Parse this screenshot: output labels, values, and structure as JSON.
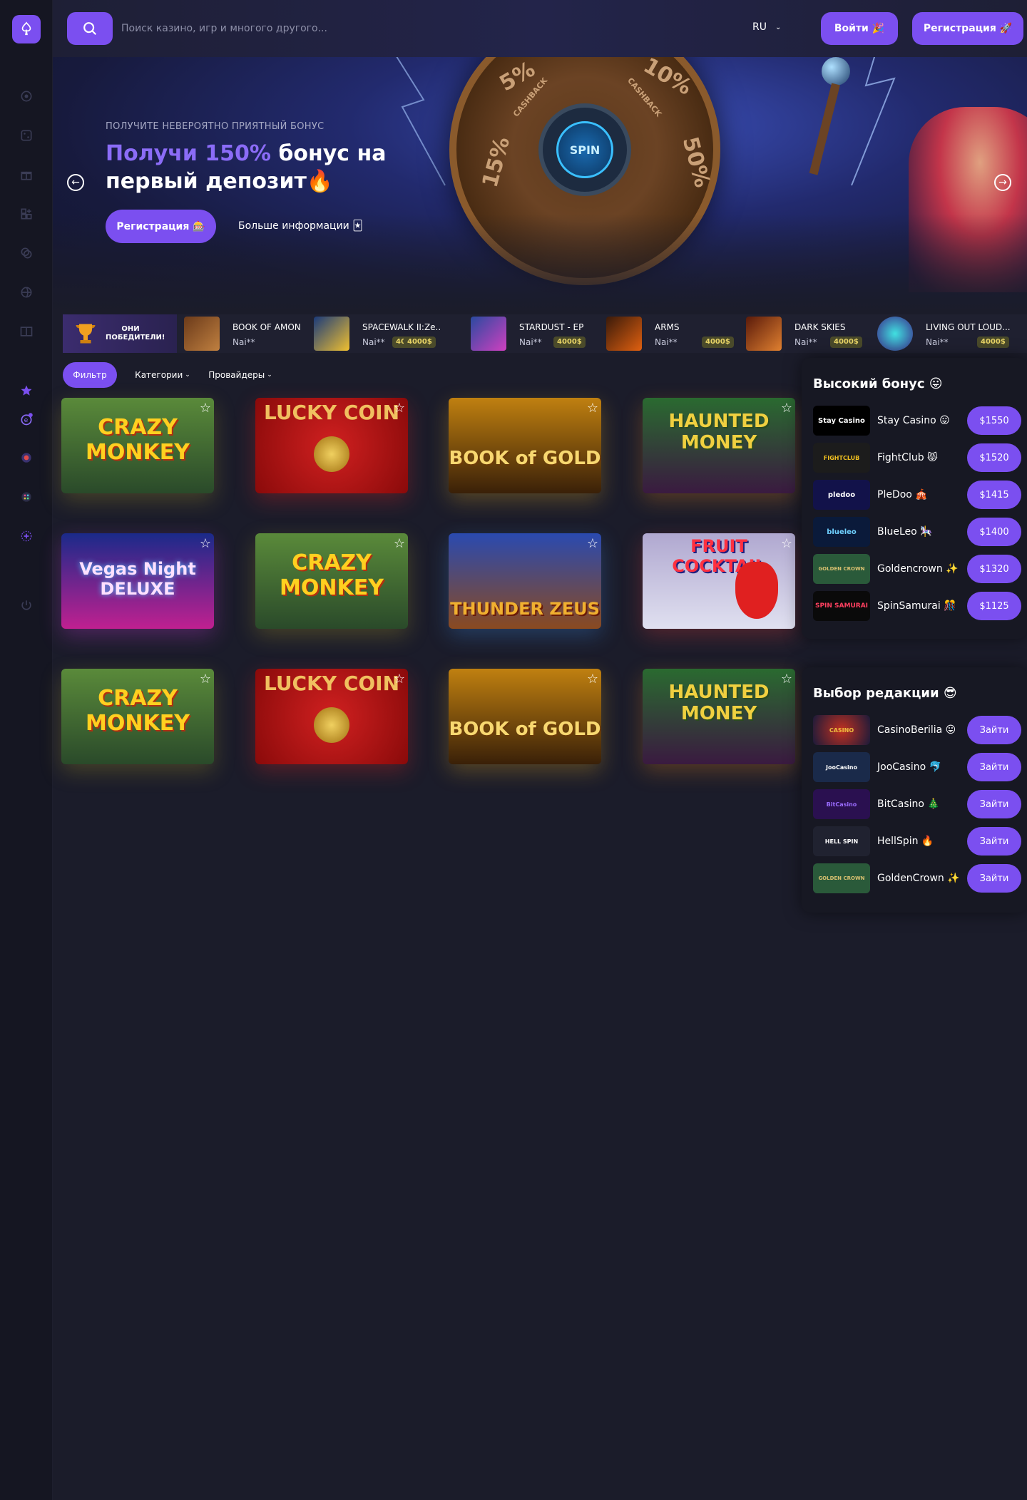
{
  "header": {
    "search_placeholder": "Поиск казино, игр и многого другого...",
    "lang": "RU",
    "login": "Войти 🎉",
    "register": "Регистрация 🚀"
  },
  "hero": {
    "subtitle": "ПОЛУЧИТЕ НЕВЕРОЯТНО ПРИЯТНЫЙ БОНУС",
    "title_accent": "Получи 150%",
    "title_rest": " бонус на первый депозит🔥",
    "cta": "Регистрация 🎰",
    "more": "Больше информации 🃏",
    "wheel": {
      "cash": "CASH",
      "p5": "5%",
      "p10": "10%",
      "p15": "15%",
      "p50": "50%",
      "spin": "SPIN",
      "cashback": "CASHBACK"
    }
  },
  "winners": {
    "badge": "ОНИ ПОБЕДИТЕЛИ!",
    "items": [
      {
        "title": "BOOK OF AMON",
        "user": "Nai**",
        "amount": "4000$"
      },
      {
        "title": "SPACEWALK II:Ze..",
        "user": "Nai**",
        "amount": "4000$"
      },
      {
        "title": "STARDUST - EP",
        "user": "Nai**",
        "amount": "4000$"
      },
      {
        "title": "ARMS",
        "user": "Nai**",
        "amount": "4000$"
      },
      {
        "title": "DARK SKIES",
        "user": "Nai**",
        "amount": "4000$"
      },
      {
        "title": "LIVING OUT LOUD...",
        "user": "Nai**",
        "amount": "4000$"
      }
    ]
  },
  "filters": {
    "filter": "Фильтр",
    "categories": "Категории",
    "providers": "Провайдеры"
  },
  "games": [
    {
      "title": "CRAZY MONKEY"
    },
    {
      "title": "LUCKY COIN"
    },
    {
      "title": "BOOK of GOLD"
    },
    {
      "title": "HAUNTED MONEY"
    },
    {
      "title": "Vegas Night DELUXE"
    },
    {
      "title": "CRAZY MONKEY"
    },
    {
      "title": "THUNDER ZEUS"
    },
    {
      "title": "FRUIT COCKTAIL"
    },
    {
      "title": "CRAZY MONKEY"
    },
    {
      "title": "LUCKY COIN"
    },
    {
      "title": "BOOK of GOLD"
    },
    {
      "title": "HAUNTED MONEY"
    }
  ],
  "bonus_panel": {
    "title": "Высокий бонус 😛",
    "items": [
      {
        "name": "Stay Casino 😛",
        "logo": "Stay Casino",
        "amount": "$1550"
      },
      {
        "name": "FightClub 😾",
        "logo": "FIGHTCLUB",
        "amount": "$1520"
      },
      {
        "name": "PleDoo 🎪",
        "logo": "pledoo",
        "amount": "$1415"
      },
      {
        "name": "BlueLeo 🎠",
        "logo": "blueleo",
        "amount": "$1400"
      },
      {
        "name": "Goldencrown ✨",
        "logo": "GOLDEN CROWN",
        "amount": "$1320"
      },
      {
        "name": "SpinSamurai 🎊",
        "logo": "SPIN SAMURAI",
        "amount": "$1125"
      }
    ]
  },
  "editor_panel": {
    "title": "Выбор редакции 😎",
    "items": [
      {
        "name": "CasinoBerilia 😛",
        "logo": "CASINO",
        "action": "Зайти"
      },
      {
        "name": "JooCasino 🐬",
        "logo": "JooCasino",
        "action": "Зайти"
      },
      {
        "name": "BitCasino 🎄",
        "logo": "BitCasino",
        "action": "Зайти"
      },
      {
        "name": "HellSpin 🔥",
        "logo": "HELL SPIN",
        "action": "Зайти"
      },
      {
        "name": "GoldenCrown ✨",
        "logo": "GOLDEN CROWN",
        "action": "Зайти"
      }
    ]
  },
  "colors": {
    "accent": "#7b4ff0",
    "bg": "#1b1c2a",
    "panel": "#171823"
  }
}
